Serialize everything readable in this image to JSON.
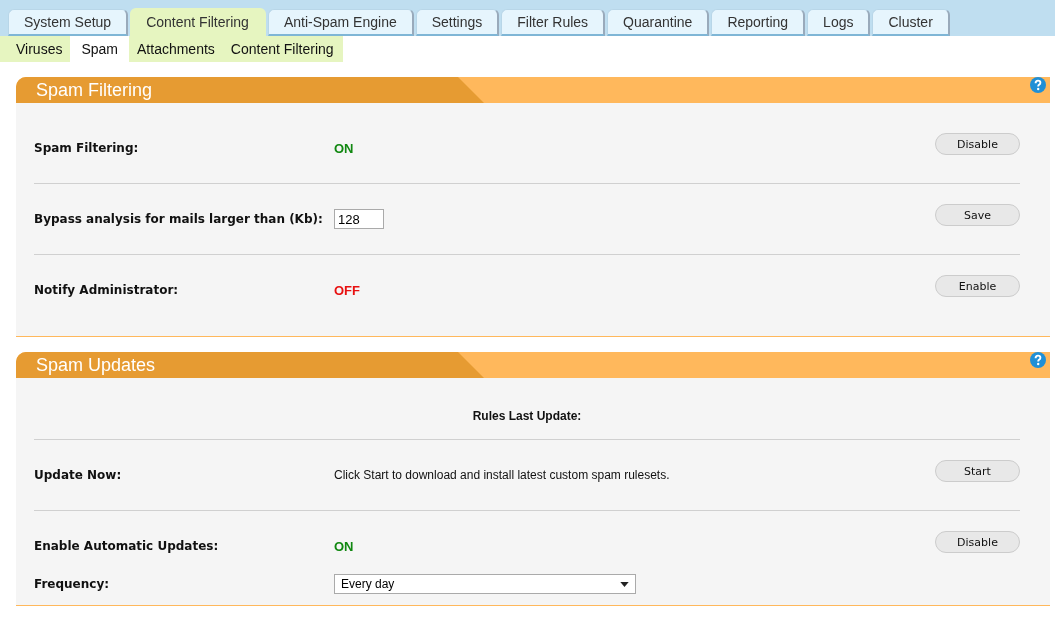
{
  "tabs": [
    {
      "label": "System Setup",
      "selected": false
    },
    {
      "label": "Content Filtering",
      "selected": true
    },
    {
      "label": "Anti-Spam Engine",
      "selected": false
    },
    {
      "label": "Settings",
      "selected": false
    },
    {
      "label": "Filter Rules",
      "selected": false
    },
    {
      "label": "Quarantine",
      "selected": false
    },
    {
      "label": "Reporting",
      "selected": false
    },
    {
      "label": "Logs",
      "selected": false
    },
    {
      "label": "Cluster",
      "selected": false
    }
  ],
  "subtabs": [
    {
      "label": "Viruses",
      "selected": false
    },
    {
      "label": "Spam",
      "selected": true
    },
    {
      "label": "Attachments",
      "selected": false
    },
    {
      "label": "Content Filtering",
      "selected": false
    }
  ],
  "panels": [
    {
      "title": "Spam Filtering",
      "rows": [
        {
          "fields": [
            {
              "kind": "status",
              "label": "Spam Filtering:",
              "value": "ON",
              "on": true
            }
          ],
          "button": "Disable"
        },
        {
          "fields": [
            {
              "kind": "input",
              "label": "Bypass analysis for mails larger than (Kb):",
              "value": "128"
            }
          ],
          "button": "Save"
        },
        {
          "fields": [
            {
              "kind": "status",
              "label": "Notify Administrator:",
              "value": "OFF",
              "on": false
            }
          ],
          "button": "Enable"
        }
      ]
    },
    {
      "title": "Spam Updates",
      "rows": [
        {
          "fields": [
            {
              "kind": "heading",
              "label": "Rules Last Update:"
            }
          ]
        },
        {
          "fields": [
            {
              "kind": "text",
              "label": "Update Now:",
              "value": "Click Start to download and install latest custom spam rulesets."
            }
          ],
          "button": "Start"
        },
        {
          "fields": [
            {
              "kind": "status",
              "label": "Enable Automatic Updates:",
              "value": "ON",
              "on": true
            },
            {
              "kind": "select",
              "label": "Frequency:",
              "value": "Every day"
            }
          ],
          "button": "Disable"
        }
      ]
    }
  ]
}
